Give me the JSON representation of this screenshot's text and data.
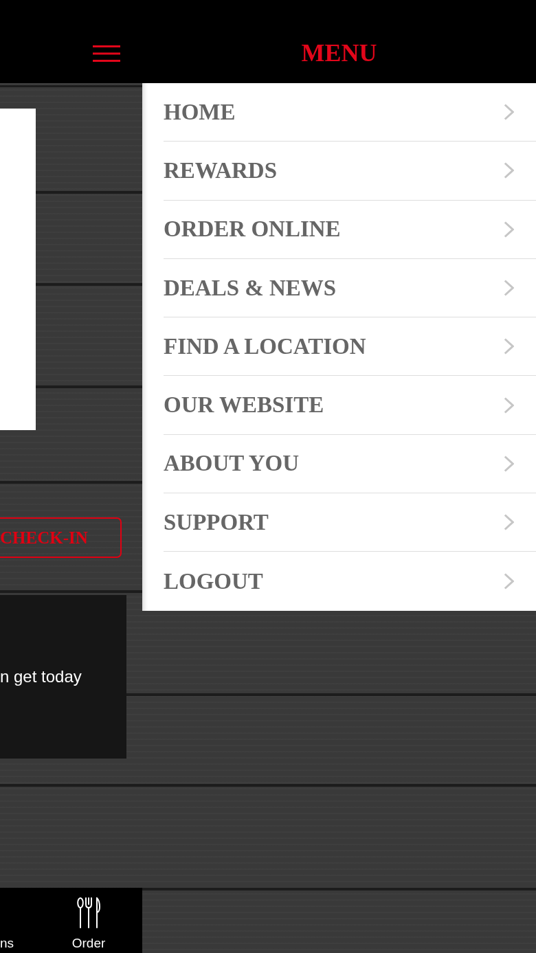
{
  "header": {
    "title": "MENU"
  },
  "background_screen": {
    "check_in_button": {
      "label": "CHECK-IN"
    },
    "message_card": {
      "text": "n get today"
    },
    "bottom_nav": [
      {
        "label": "ns",
        "kind": "text"
      },
      {
        "label": "Order",
        "kind": "icon"
      }
    ]
  },
  "menu": {
    "items": [
      {
        "label": "HOME"
      },
      {
        "label": "REWARDS"
      },
      {
        "label": "ORDER ONLINE"
      },
      {
        "label": "DEALS & NEWS"
      },
      {
        "label": "FIND A LOCATION"
      },
      {
        "label": "OUR WEBSITE"
      },
      {
        "label": "ABOUT YOU"
      },
      {
        "label": "SUPPORT"
      },
      {
        "label": "LOGOUT"
      }
    ]
  }
}
